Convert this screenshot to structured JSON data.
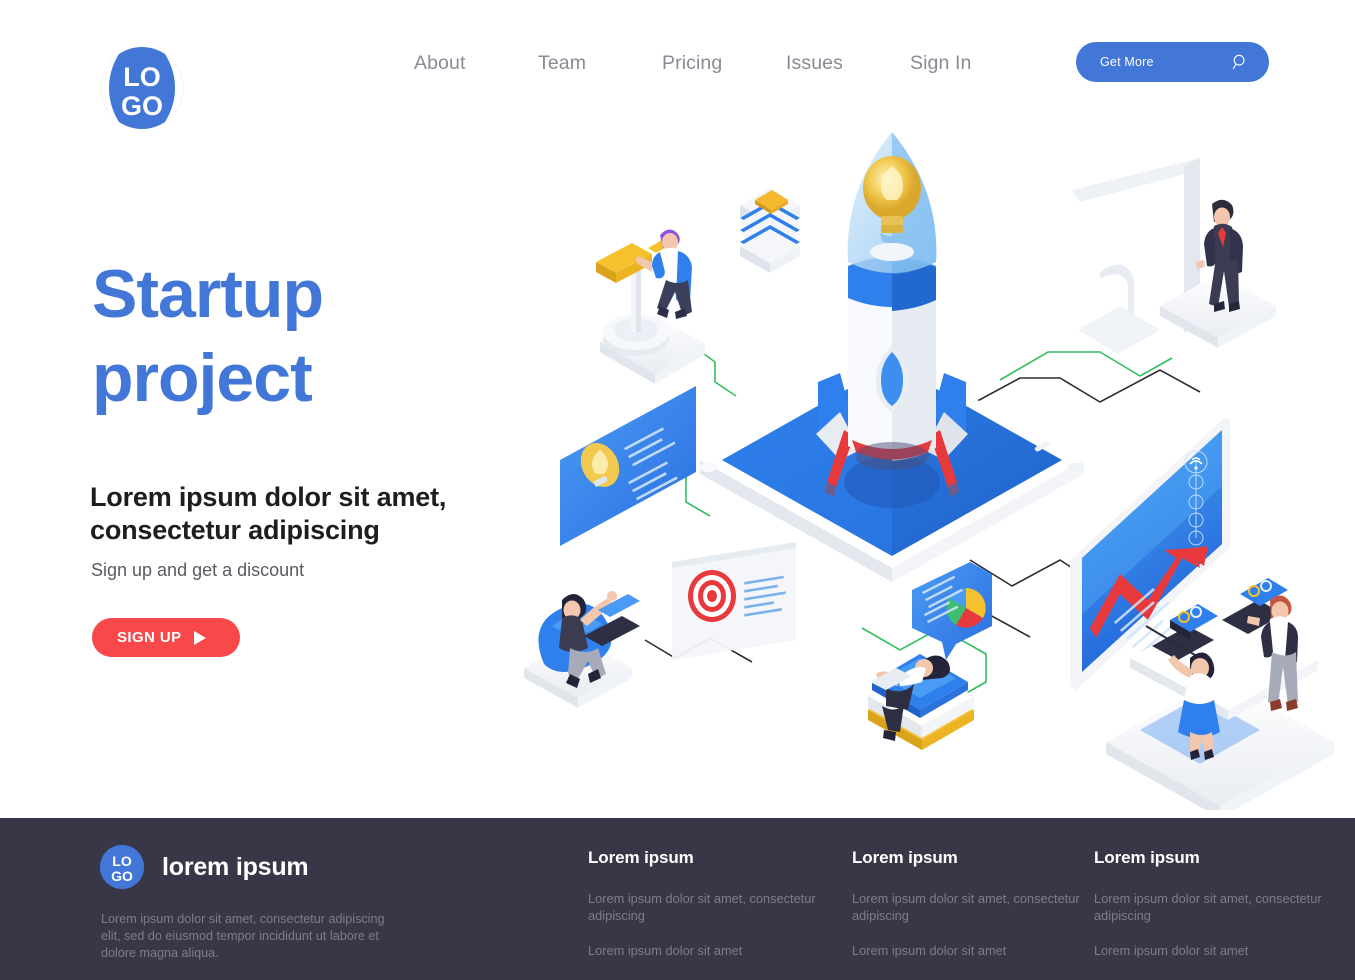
{
  "header": {
    "logo": {
      "name": "logo-mark",
      "line1": "LO",
      "line2": "GO",
      "color": "#4277d8"
    },
    "nav": [
      {
        "label": "About"
      },
      {
        "label": "Team"
      },
      {
        "label": "Pricing"
      },
      {
        "label": "Issues"
      },
      {
        "label": "Sign In"
      }
    ],
    "cta": {
      "label": "Get More",
      "icon": "search-icon",
      "bg": "#4277d8",
      "text_color": "#ffffff"
    }
  },
  "hero": {
    "title_line1": "Startup",
    "title_line2": "project",
    "title_color": "#4277d8",
    "subtitle_line1": "Lorem ipsum dolor sit amet,",
    "subtitle_line2": "consectetur adipiscing",
    "note": "Sign up and get a discount",
    "button": {
      "label": "SIGN UP",
      "icon": "play-triangle-icon",
      "bg": "#f9484a"
    }
  },
  "illustration": {
    "name": "isometric-startup-rocket-scene",
    "elements": [
      "rocket-with-lightbulb",
      "tablet-launchpad",
      "stacked-layers-block",
      "person-with-telescope",
      "desktop-monitor-with-businessman",
      "analytics-screen-with-red-arrow",
      "two-people-at-desk-with-laptops",
      "person-in-beanbag-with-laptop",
      "lightbulb-info-card",
      "target-dartboard-card",
      "pie-chart-speech-bubble",
      "person-reading-on-books"
    ],
    "accent_blue": "#2f80ed",
    "accent_red": "#e8393c",
    "accent_yellow": "#f5b82e",
    "connector_green": "#2fbf5f",
    "connector_dark": "#2c2c34"
  },
  "footer": {
    "bg": "#383747",
    "logo": {
      "line1": "LO",
      "line2": "GO",
      "bg": "#4277d8"
    },
    "brand": "lorem ipsum",
    "description": "Lorem ipsum dolor sit amet, consectetur adipiscing elit, sed do eiusmod tempor incididunt ut labore et dolore magna aliqua.",
    "columns": [
      {
        "title": "Lorem ipsum",
        "links": [
          "Lorem ipsum dolor sit amet, consectetur adipiscing",
          "Lorem ipsum dolor sit amet"
        ]
      },
      {
        "title": "Lorem ipsum",
        "links": [
          "Lorem ipsum dolor sit amet, consectetur adipiscing",
          "Lorem ipsum dolor sit amet"
        ]
      },
      {
        "title": "Lorem ipsum",
        "links": [
          "Lorem ipsum dolor sit amet, consectetur adipiscing",
          "Lorem ipsum dolor sit amet"
        ]
      }
    ]
  }
}
